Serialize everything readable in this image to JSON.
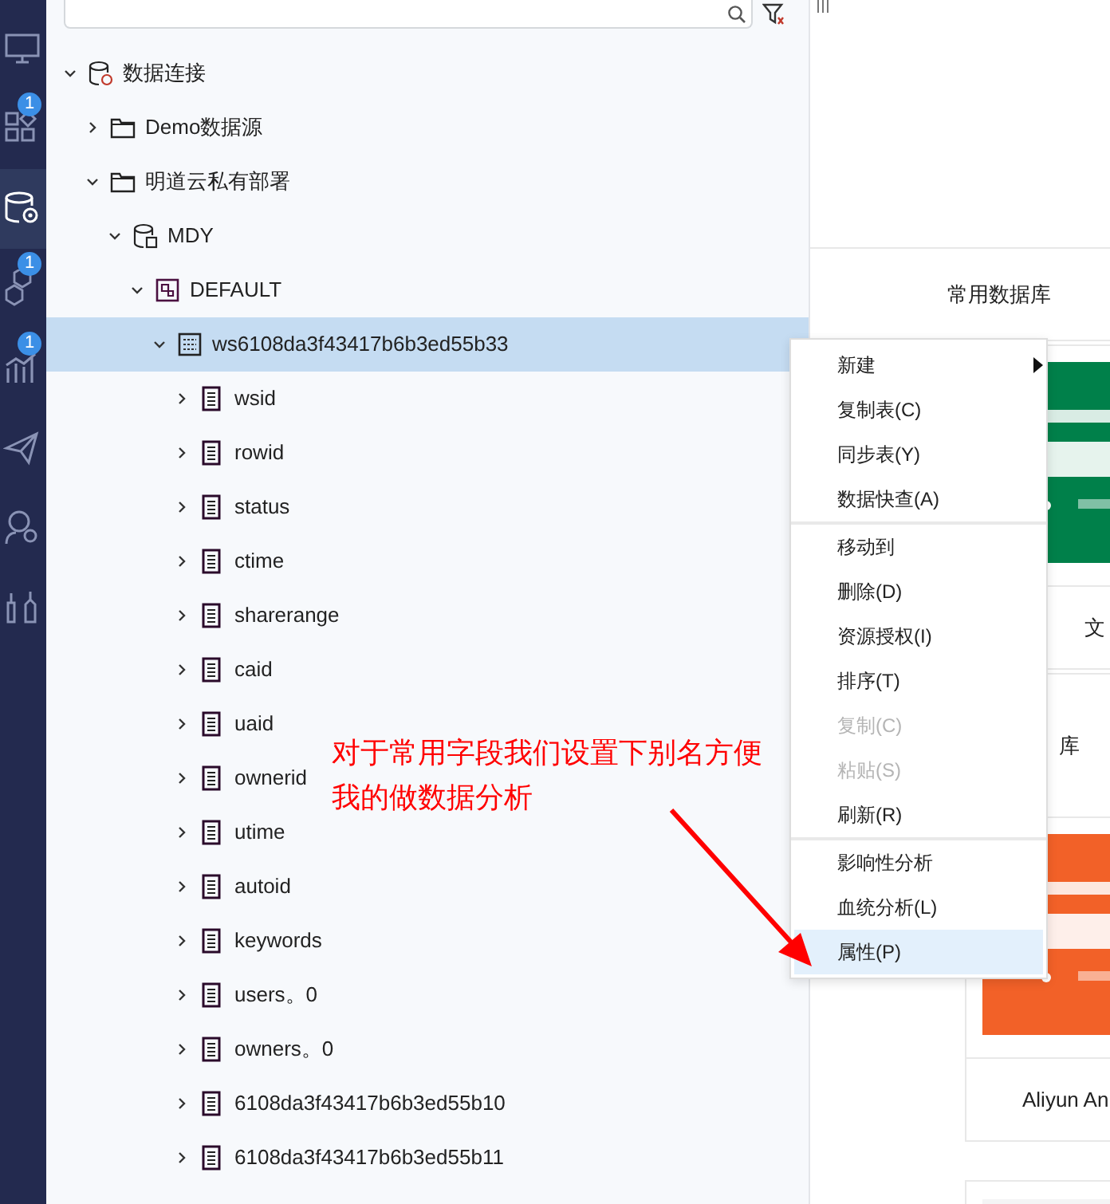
{
  "rail": [
    {
      "selected": false
    },
    {
      "selected": false,
      "badge": "1"
    },
    {
      "selected": true
    },
    {
      "selected": false,
      "badge": "1"
    },
    {
      "selected": false,
      "badge": "1"
    },
    {
      "selected": false
    },
    {
      "selected": false
    },
    {
      "selected": false
    }
  ],
  "tree": [
    {
      "kind": "root",
      "label": "数据连接",
      "expanded": true,
      "selected": false,
      "children": [
        {
          "kind": "folder",
          "label": "Demo数据源",
          "expanded": false,
          "selected": false
        },
        {
          "kind": "folder",
          "label": "明道云私有部署",
          "expanded": true,
          "selected": false,
          "children": [
            {
              "kind": "database",
              "label": "MDY",
              "expanded": true,
              "selected": false,
              "children": [
                {
                  "kind": "schema",
                  "label": "DEFAULT",
                  "expanded": true,
                  "selected": false,
                  "children": [
                    {
                      "kind": "table",
                      "label": "ws6108da3f43417b6b3ed55b33",
                      "expanded": true,
                      "selected": true,
                      "children": [
                        {
                          "kind": "column",
                          "label": "wsid",
                          "expanded": false,
                          "selected": false
                        },
                        {
                          "kind": "column",
                          "label": "rowid",
                          "expanded": false,
                          "selected": false
                        },
                        {
                          "kind": "column",
                          "label": "status",
                          "expanded": false,
                          "selected": false
                        },
                        {
                          "kind": "column",
                          "label": "ctime",
                          "expanded": false,
                          "selected": false
                        },
                        {
                          "kind": "column",
                          "label": "sharerange",
                          "expanded": false,
                          "selected": false
                        },
                        {
                          "kind": "column",
                          "label": "caid",
                          "expanded": false,
                          "selected": false
                        },
                        {
                          "kind": "column",
                          "label": "uaid",
                          "expanded": false,
                          "selected": false
                        },
                        {
                          "kind": "column",
                          "label": "ownerid",
                          "expanded": false,
                          "selected": false
                        },
                        {
                          "kind": "column",
                          "label": "utime",
                          "expanded": false,
                          "selected": false
                        },
                        {
                          "kind": "column",
                          "label": "autoid",
                          "expanded": false,
                          "selected": false
                        },
                        {
                          "kind": "column",
                          "label": "keywords",
                          "expanded": false,
                          "selected": false
                        },
                        {
                          "kind": "column",
                          "label": "users。0",
                          "expanded": false,
                          "selected": false
                        },
                        {
                          "kind": "column",
                          "label": "owners。0",
                          "expanded": false,
                          "selected": false
                        },
                        {
                          "kind": "column",
                          "label": "6108da3f43417b6b3ed55b10",
                          "expanded": false,
                          "selected": false
                        },
                        {
                          "kind": "column",
                          "label": "6108da3f43417b6b3ed55b11",
                          "expanded": false,
                          "selected": false
                        }
                      ]
                    }
                  ]
                }
              ]
            }
          ]
        }
      ]
    }
  ],
  "right_panel": {
    "section_title": "常用数据库",
    "cards": [
      {
        "kind": "picture",
        "color": "#00804a",
        "label": "文"
      },
      {
        "kind": "picture",
        "color": "#f26128",
        "top_label": "库",
        "label": "Aliyun An"
      },
      {
        "kind": "empty"
      }
    ]
  },
  "context_menu": {
    "groups": [
      [
        {
          "label": "新建",
          "submenu": true,
          "disabled": false,
          "selected": false
        },
        {
          "label": "复制表(C)",
          "submenu": false,
          "disabled": false,
          "selected": false
        },
        {
          "label": "同步表(Y)",
          "submenu": false,
          "disabled": false,
          "selected": false
        },
        {
          "label": "数据快查(A)",
          "submenu": false,
          "disabled": false,
          "selected": false
        }
      ],
      [
        {
          "label": "移动到",
          "submenu": false,
          "disabled": false,
          "selected": false
        },
        {
          "label": "删除(D)",
          "submenu": false,
          "disabled": false,
          "selected": false
        },
        {
          "label": "资源授权(I)",
          "submenu": false,
          "disabled": false,
          "selected": false
        },
        {
          "label": "排序(T)",
          "submenu": false,
          "disabled": false,
          "selected": false
        },
        {
          "label": "复制(C)",
          "submenu": false,
          "disabled": true,
          "selected": false
        },
        {
          "label": "粘贴(S)",
          "submenu": false,
          "disabled": true,
          "selected": false
        },
        {
          "label": "刷新(R)",
          "submenu": false,
          "disabled": false,
          "selected": false
        }
      ],
      [
        {
          "label": "影响性分析",
          "submenu": false,
          "disabled": false,
          "selected": false
        },
        {
          "label": "血统分析(L)",
          "submenu": false,
          "disabled": false,
          "selected": false
        },
        {
          "label": "属性(P)",
          "submenu": false,
          "disabled": false,
          "selected": true
        }
      ]
    ]
  },
  "annotation": {
    "lines": [
      "对于常用字段我们设置下别名方便",
      "我的做数据分析"
    ]
  }
}
